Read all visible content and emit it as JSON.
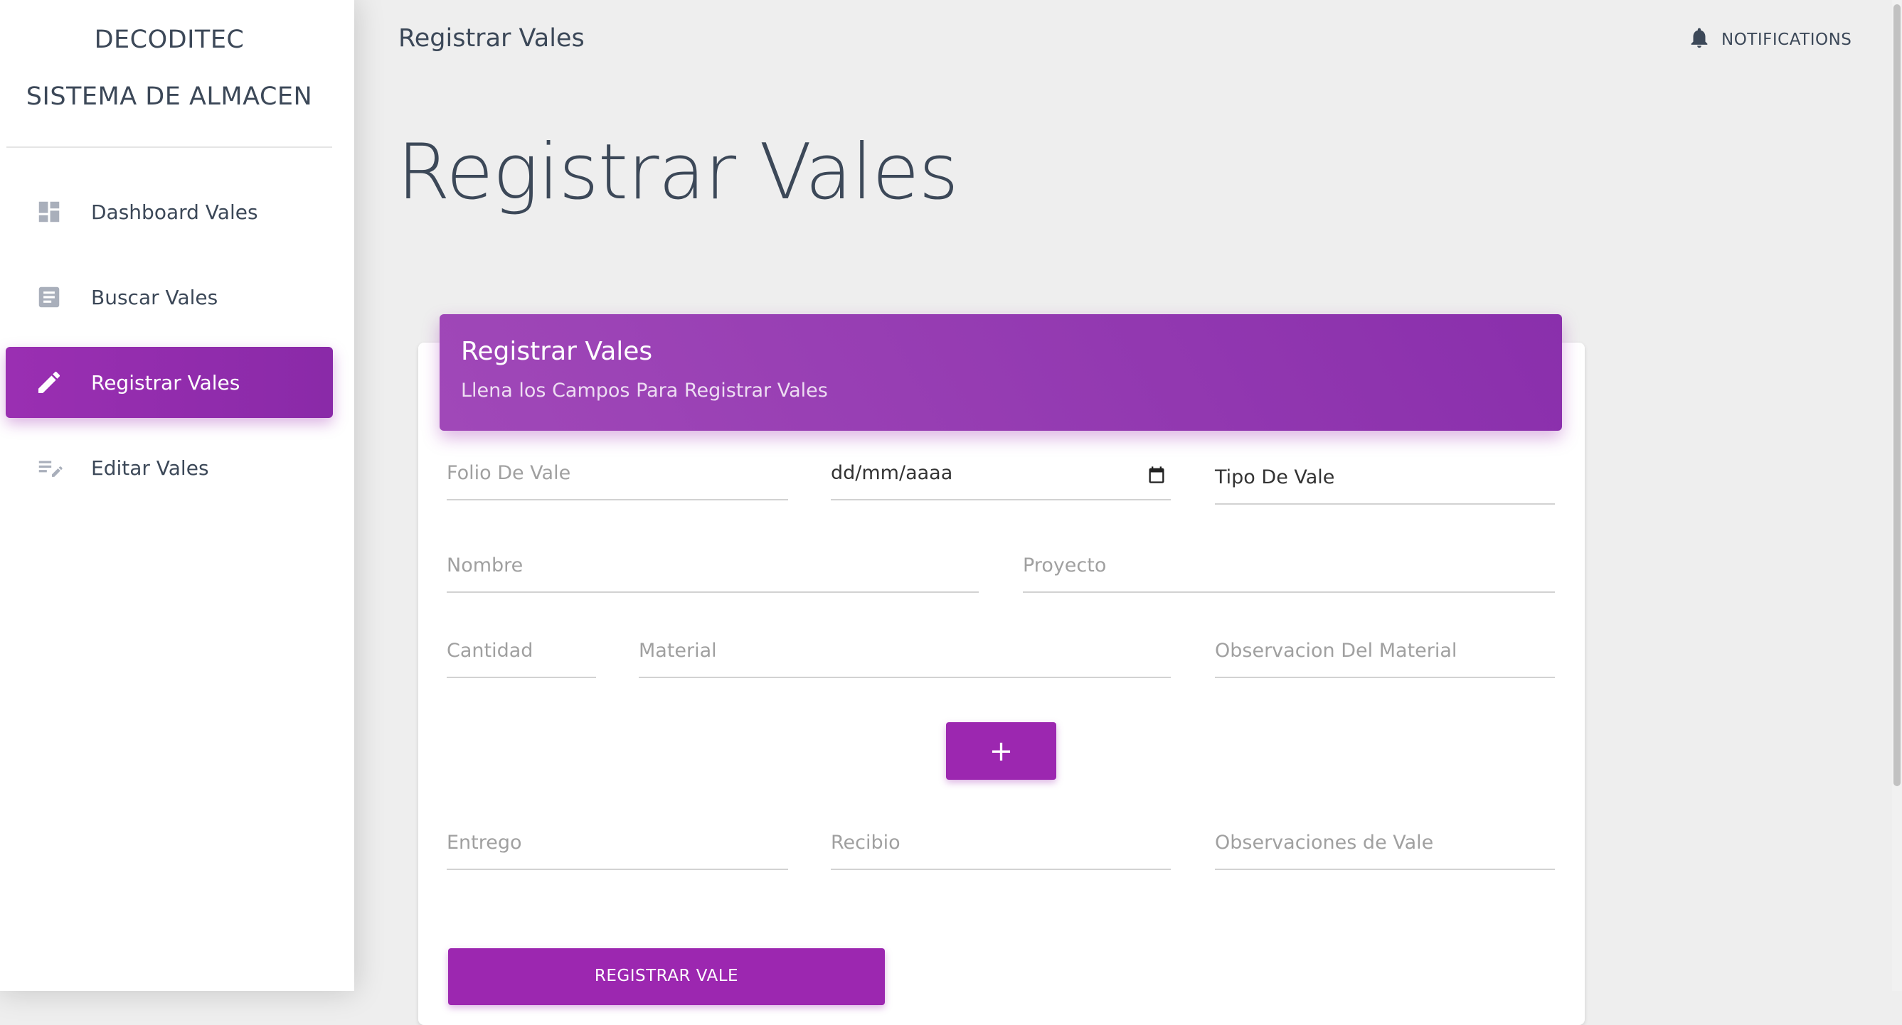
{
  "sidebar": {
    "brand_line1": "DECODITEC",
    "brand_line2": "SISTEMA DE ALMACEN",
    "items": [
      {
        "label": "Dashboard Vales",
        "icon": "dashboard-icon"
      },
      {
        "label": "Buscar Vales",
        "icon": "description-icon"
      },
      {
        "label": "Registrar Vales",
        "icon": "pencil-icon",
        "active": true
      },
      {
        "label": "Editar Vales",
        "icon": "edit-list-icon"
      }
    ]
  },
  "header": {
    "title": "Registrar Vales",
    "notifications_label": "NOTIFICATIONS"
  },
  "main": {
    "page_title": "Registrar Vales"
  },
  "card": {
    "title": "Registrar Vales",
    "subtitle": "Llena los Campos Para Registrar Vales",
    "fields": {
      "folio": {
        "placeholder": "Folio De Vale"
      },
      "fecha": {
        "value": "dd/mm/aaaa"
      },
      "tipo": {
        "value": "Tipo De Vale"
      },
      "nombre": {
        "placeholder": "Nombre"
      },
      "proyecto": {
        "placeholder": "Proyecto"
      },
      "cantidad": {
        "placeholder": "Cantidad"
      },
      "material": {
        "placeholder": "Material"
      },
      "observacion_material": {
        "placeholder": "Observacion Del Material"
      },
      "entrego": {
        "placeholder": "Entrego"
      },
      "recibio": {
        "placeholder": "Recibio"
      },
      "observaciones_vale": {
        "placeholder": "Observaciones de Vale"
      }
    },
    "add_button_label": "+",
    "submit_button_label": "REGISTRAR VALE"
  },
  "colors": {
    "accent": "#9c27b0",
    "text": "#3c4858"
  }
}
